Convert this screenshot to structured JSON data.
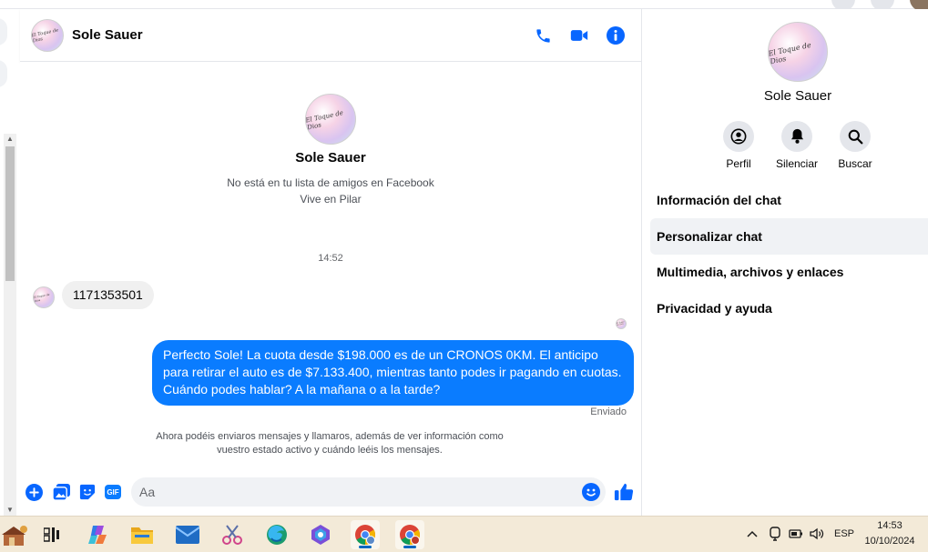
{
  "chat": {
    "contact_name": "Sole Sauer",
    "avatar_text": "El Toque de Dios",
    "profile_note": "No está en tu lista de amigos en Facebook",
    "profile_location": "Vive en Pilar",
    "time_label": "14:52",
    "incoming_message": "1171353501",
    "outgoing_message": "Perfecto Sole! La cuota desde $198.000 es de un CRONOS 0KM. El anticipo para retirar el auto es de $7.133.400, mientras tanto podes ir pagando en cuotas. Cuándo podes hablar? A la mañana o a la tarde?",
    "sent_status": "Enviado",
    "notice": "Ahora podéis enviaros mensajes y llamaros, además de ver información como vuestro estado activo y cuándo leéis los mensajes.",
    "composer_placeholder": "Aa",
    "gif_label": "GIF"
  },
  "side_panel": {
    "name": "Sole Sauer",
    "actions": [
      {
        "label": "Perfil",
        "icon": "profile-icon"
      },
      {
        "label": "Silenciar",
        "icon": "bell-icon"
      },
      {
        "label": "Buscar",
        "icon": "search-icon"
      }
    ],
    "menu": [
      {
        "label": "Información del chat",
        "active": false
      },
      {
        "label": "Personalizar chat",
        "active": true
      },
      {
        "label": "Multimedia, archivos y enlaces",
        "active": false
      },
      {
        "label": "Privacidad y ayuda",
        "active": false
      }
    ]
  },
  "taskbar": {
    "language": "ESP",
    "time": "14:53",
    "date": "10/10/2024",
    "apps": [
      "task-view-icon",
      "copilot-icon",
      "file-explorer-icon",
      "mail-icon",
      "snipping-tool-icon",
      "edge-icon",
      "copilot-pro-icon",
      "chrome-icon",
      "chrome-profile-icon"
    ]
  },
  "colors": {
    "accent": "#0a7cff",
    "icon_blue": "#0866ff",
    "bubble_in": "#f0f0f0",
    "taskbar": "#f3ead8"
  }
}
